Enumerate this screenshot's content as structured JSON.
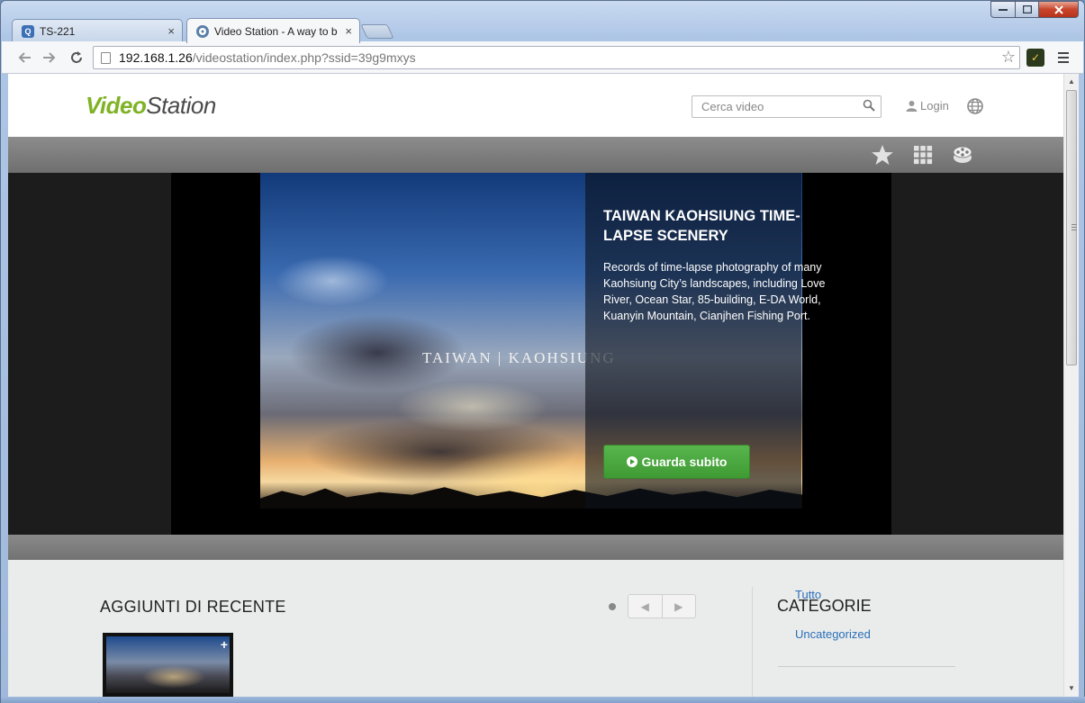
{
  "browser": {
    "tabs": [
      {
        "title": "TS-221",
        "close": "×"
      },
      {
        "title": "Video Station - A way to b",
        "close": "×"
      }
    ],
    "address": {
      "host": "192.168.1.26",
      "path": "/videostation/index.php?ssid=39g9mxys"
    }
  },
  "header": {
    "logo_video": "Video",
    "logo_station": "Station",
    "search_placeholder": "Cerca video",
    "login_label": "Login"
  },
  "hero": {
    "image_text": "TAIWAN   |   KAOHSIUNG",
    "title": "TAIWAN KAOHSIUNG TIME-LAPSE SCENERY",
    "description": "Records of time-lapse photography of many Kaohsiung City’s landscapes, including Love River, Ocean Star, 85-building, E-DA World, Kuanyin Mountain, Cianjhen Fishing Port.",
    "watch_button": "Guarda subito"
  },
  "recent": {
    "title": "AGGIUNTI DI RECENTE",
    "prev": "◀",
    "next": "▶",
    "thumb_plus": "+"
  },
  "categories": {
    "title": "CATEGORIE",
    "items": [
      "Tutto",
      "Uncategorized"
    ]
  },
  "colors": {
    "brand_green": "#7fb224",
    "button_green": "#4aa83e",
    "link_blue": "#2a6fb8"
  }
}
